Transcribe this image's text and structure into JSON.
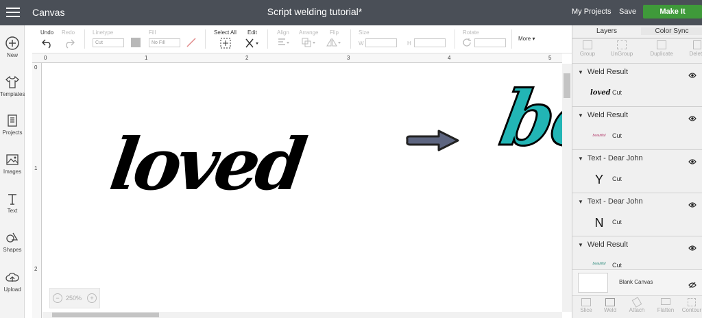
{
  "header": {
    "app_title": "Canvas",
    "doc_title": "Script welding tutorial*",
    "my_projects": "My Projects",
    "save": "Save",
    "make_it": "Make It"
  },
  "sidebar": {
    "items": [
      {
        "label": "New",
        "icon": "plus-circle-icon"
      },
      {
        "label": "Templates",
        "icon": "tshirt-icon"
      },
      {
        "label": "Projects",
        "icon": "projects-icon"
      },
      {
        "label": "Images",
        "icon": "image-icon"
      },
      {
        "label": "Text",
        "icon": "text-icon"
      },
      {
        "label": "Shapes",
        "icon": "shapes-icon"
      },
      {
        "label": "Upload",
        "icon": "upload-cloud-icon"
      }
    ]
  },
  "toolbar": {
    "undo": "Undo",
    "redo": "Redo",
    "linetype": "Linetype",
    "linetype_value": "Cut",
    "fill": "Fill",
    "fill_value": "No Fill",
    "select_all": "Select All",
    "edit": "Edit",
    "align": "Align",
    "arrange": "Arrange",
    "flip": "Flip",
    "size": "Size",
    "w": "W",
    "h": "H",
    "rotate": "Rotate",
    "more": "More"
  },
  "rulers": {
    "top": [
      "0",
      "1",
      "2",
      "3",
      "4",
      "5"
    ],
    "left": [
      "0",
      "1",
      "2"
    ]
  },
  "canvas": {
    "word_loved": "loved",
    "word_be": "be"
  },
  "zoom": {
    "value": "250%"
  },
  "panel": {
    "tabs": [
      "Layers",
      "Color Sync"
    ],
    "tools": [
      "Group",
      "UnGroup",
      "Duplicate",
      "Delete"
    ],
    "layers": [
      {
        "title": "Weld Result",
        "item": "Cut",
        "thumb": "loved"
      },
      {
        "title": "Weld Result",
        "item": "Cut",
        "thumb": "beautiful"
      },
      {
        "title": "Text - Dear John",
        "item": "Cut",
        "thumb": "Y"
      },
      {
        "title": "Text - Dear John",
        "item": "Cut",
        "thumb": "N"
      },
      {
        "title": "Weld Result",
        "item": "Cut",
        "thumb": "beautiful"
      }
    ],
    "blank_canvas": "Blank Canvas",
    "bottom_tools": [
      "Slice",
      "Weld",
      "Attach",
      "Flatten",
      "Contour"
    ]
  },
  "colors": {
    "topbar": "#4a4f57",
    "make_it": "#3f9a3a",
    "teal": "#22b5b5",
    "arrow": "#5d6580"
  }
}
